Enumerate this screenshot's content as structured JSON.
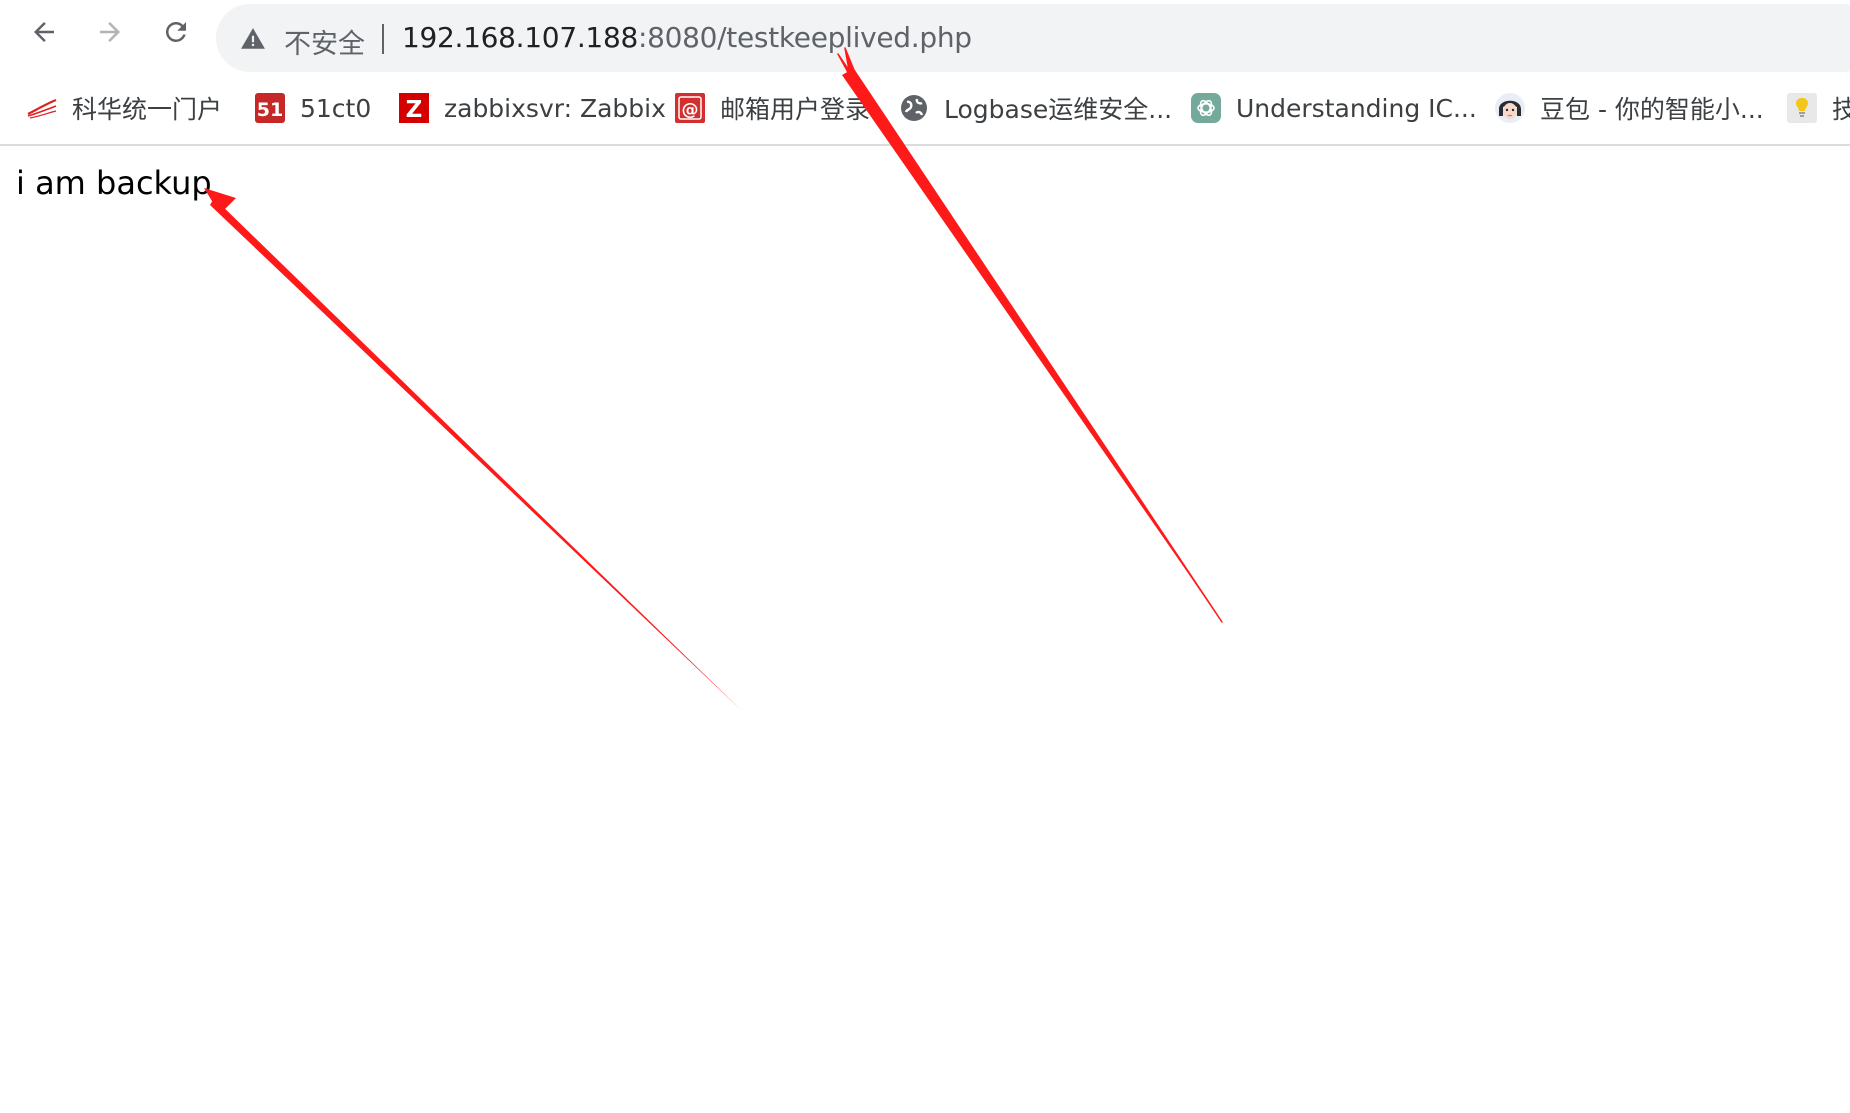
{
  "toolbar": {
    "back_icon": "arrow-left-icon",
    "forward_icon": "arrow-right-icon",
    "reload_icon": "reload-icon"
  },
  "omnibox": {
    "security_label": "不安全",
    "url_host": "192.168.107.188",
    "url_rest": ":8080/testkeeplived.php"
  },
  "bookmarks": [
    {
      "label": "科华统一门户",
      "icon": "kehua-logo-icon"
    },
    {
      "label": "51ct0",
      "icon": "51cto-logo-icon"
    },
    {
      "label": "zabbixsvr: Zabbix",
      "icon": "zabbix-logo-icon"
    },
    {
      "label": "邮箱用户登录",
      "icon": "mail-at-icon"
    },
    {
      "label": "Logbase运维安全...",
      "icon": "globe-icon"
    },
    {
      "label": "Understanding IC...",
      "icon": "chatgpt-logo-icon"
    },
    {
      "label": "豆包 - 你的智能小...",
      "icon": "doubao-avatar-icon"
    },
    {
      "label": "技",
      "icon": "lightbulb-icon"
    }
  ],
  "page": {
    "text": "i am backup"
  },
  "colors": {
    "annotation_arrow": "#ff1a1a",
    "omnibox_bg": "#f1f3f4",
    "zabbix_red": "#d40000",
    "cto_red": "#c62828"
  }
}
